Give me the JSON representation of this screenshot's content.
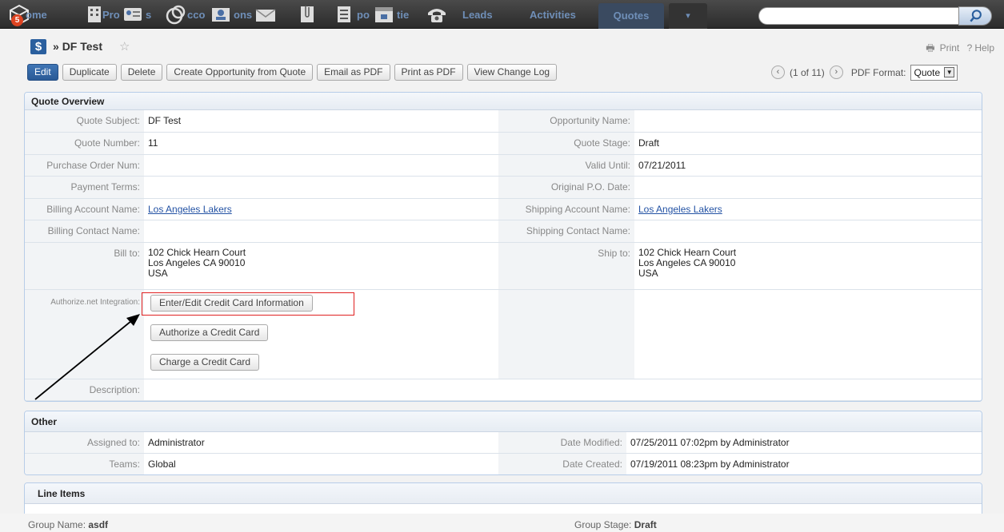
{
  "nav": {
    "badge": "5",
    "items": [
      "ome",
      "Pro",
      "s",
      "cco",
      "ons",
      "po",
      "tie",
      "Leads",
      "Activities"
    ],
    "active_tab": "Quotes",
    "more": "▾",
    "search_placeholder": ""
  },
  "header": {
    "module_icon": "$",
    "breadcrumb_sep": "»",
    "title": "DF Test",
    "print": "Print",
    "help": "Help"
  },
  "actions": {
    "edit": "Edit",
    "duplicate": "Duplicate",
    "delete": "Delete",
    "create_opp": "Create Opportunity from Quote",
    "email_pdf": "Email as PDF",
    "print_pdf": "Print as PDF",
    "change_log": "View Change Log"
  },
  "pager": {
    "text": "(1 of 11)",
    "pdf_label": "PDF Format:",
    "pdf_value": "Quote"
  },
  "overview": {
    "title": "Quote Overview",
    "quote_subject_label": "Quote Subject:",
    "quote_subject": "DF Test",
    "opportunity_label": "Opportunity Name:",
    "opportunity": "",
    "quote_number_label": "Quote Number:",
    "quote_number": "11",
    "quote_stage_label": "Quote Stage:",
    "quote_stage": "Draft",
    "po_num_label": "Purchase Order Num:",
    "po_num": "",
    "valid_until_label": "Valid Until:",
    "valid_until": "07/21/2011",
    "payment_terms_label": "Payment Terms:",
    "payment_terms": "",
    "orig_po_date_label": "Original P.O. Date:",
    "orig_po_date": "",
    "billing_account_label": "Billing Account Name:",
    "billing_account": "Los Angeles Lakers",
    "shipping_account_label": "Shipping Account Name:",
    "shipping_account": "Los Angeles Lakers",
    "billing_contact_label": "Billing Contact Name:",
    "billing_contact": "",
    "shipping_contact_label": "Shipping Contact Name:",
    "shipping_contact": "",
    "bill_to_label": "Bill to:",
    "bill_to": [
      "102 Chick Hearn Court",
      "Los Angeles CA  90010",
      "USA"
    ],
    "ship_to_label": "Ship to:",
    "ship_to": [
      "102 Chick Hearn Court",
      "Los Angeles CA  90010",
      "USA"
    ],
    "authnet_label": "Authorize.net Integration:",
    "cc_enter": "Enter/Edit Credit Card Information",
    "cc_authorize": "Authorize a Credit Card",
    "cc_charge": "Charge a Credit Card",
    "description_label": "Description:",
    "description": ""
  },
  "other": {
    "title": "Other",
    "assigned_label": "Assigned to:",
    "assigned": "Administrator",
    "modified_label": "Date Modified:",
    "modified": "07/25/2011 07:02pm by Administrator",
    "teams_label": "Teams:",
    "teams": "Global",
    "created_label": "Date Created:",
    "created": "07/19/2011 08:23pm by Administrator"
  },
  "line_items": {
    "title": "Line Items",
    "group_name_label": "Group Name:",
    "group_name": "asdf",
    "group_stage_label": "Group Stage:",
    "group_stage": "Draft"
  },
  "colors": {
    "accent": "#2a5f9e",
    "highlight": "#e02020",
    "link": "#2352a4"
  }
}
